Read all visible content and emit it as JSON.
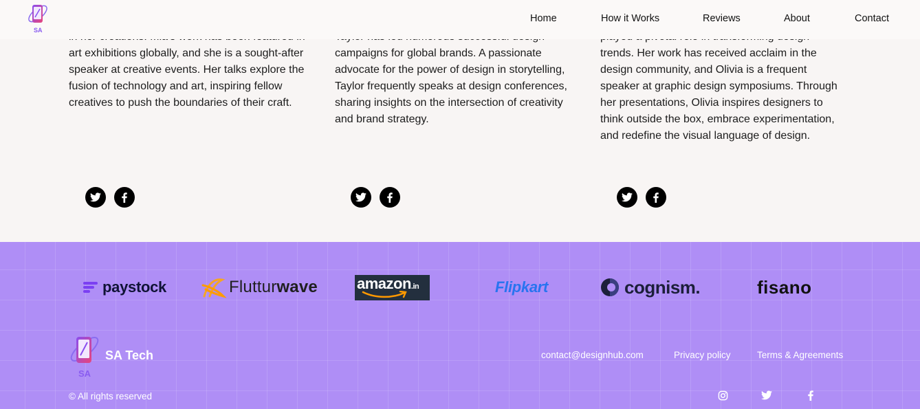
{
  "header": {
    "logo_text": "SA",
    "nav": [
      "Home",
      "How it Works",
      "Reviews",
      "About",
      "Contact"
    ]
  },
  "bios": [
    {
      "lines": [
        "in her creations. Mia's work has been featured in",
        "art exhibitions globally, and she is a sought-after",
        "speaker at creative events. Her talks explore the",
        "fusion of technology and art, inspiring fellow",
        "creatives to push the boundaries of their craft."
      ]
    },
    {
      "lines": [
        "Taylor has led numerous successful design",
        "campaigns for global brands. A passionate",
        "advocate for the power of design in storytelling,",
        "Taylor frequently speaks at design conferences,",
        "sharing insights on the intersection of creativity",
        "and brand strategy."
      ]
    },
    {
      "lines": [
        "played a pivotal role in transforming design",
        "trends. Her work has received acclaim in the",
        "design community, and Olivia is a frequent",
        "speaker at graphic design symposiums. Through",
        "her presentations, Olivia inspires designers to",
        "think outside the box, embrace experimentation,",
        "and redefine the visual language of design."
      ]
    }
  ],
  "social_icons": [
    "twitter-icon",
    "facebook-icon"
  ],
  "brands": {
    "paystock": "paystock",
    "flutter_a": "Fluttur",
    "flutter_b": "wave",
    "amazon": "amazon",
    "amazon_suffix": ".in",
    "flipkart": "Flipkart",
    "cognism": "cognism.",
    "fisano": "fisano"
  },
  "footer": {
    "logo_text": "SA",
    "title": "SA Tech",
    "links": {
      "email": "contact@designhub.com",
      "privacy": "Privacy policy",
      "terms": "Terms & Agreements"
    },
    "copyright": "© All rights reserved",
    "icons": [
      "instagram-icon",
      "twitter-icon",
      "facebook-icon"
    ]
  },
  "colors": {
    "footer_bg": "#af8ef6",
    "page_bg": "#f8f5f4",
    "flipkart_blue": "#2874f0",
    "paystock_purple": "#7b3ff2"
  }
}
